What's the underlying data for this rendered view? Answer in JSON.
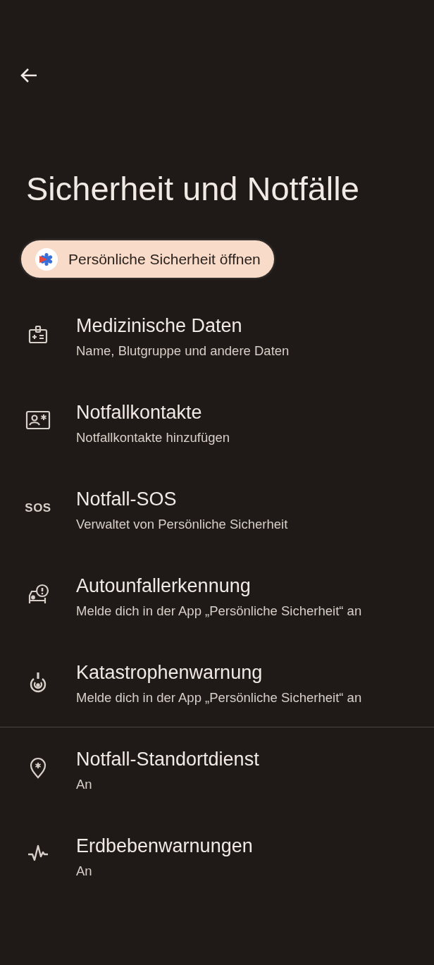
{
  "page_title": "Sicherheit und Notfälle",
  "open_app_button": {
    "label": "Persönliche Sicherheit öffnen"
  },
  "sections": [
    {
      "items": [
        {
          "title": "Medizinische Daten",
          "subtitle": "Name, Blutgruppe und andere Daten"
        },
        {
          "title": "Notfallkontakte",
          "subtitle": "Notfallkontakte hinzufügen"
        },
        {
          "title": "Notfall-SOS",
          "subtitle": "Verwaltet von Persönliche Sicherheit",
          "icon_text": "SOS"
        },
        {
          "title": "Autounfallerkennung",
          "subtitle": "Melde dich in der App „Persönliche Sicherheit“ an"
        },
        {
          "title": "Katastrophenwarnung",
          "subtitle": "Melde dich in der App „Persönliche Sicherheit“ an"
        }
      ]
    },
    {
      "items": [
        {
          "title": "Notfall-Standortdienst",
          "subtitle": "An"
        },
        {
          "title": "Erdbebenwarnungen",
          "subtitle": "An"
        }
      ]
    }
  ]
}
